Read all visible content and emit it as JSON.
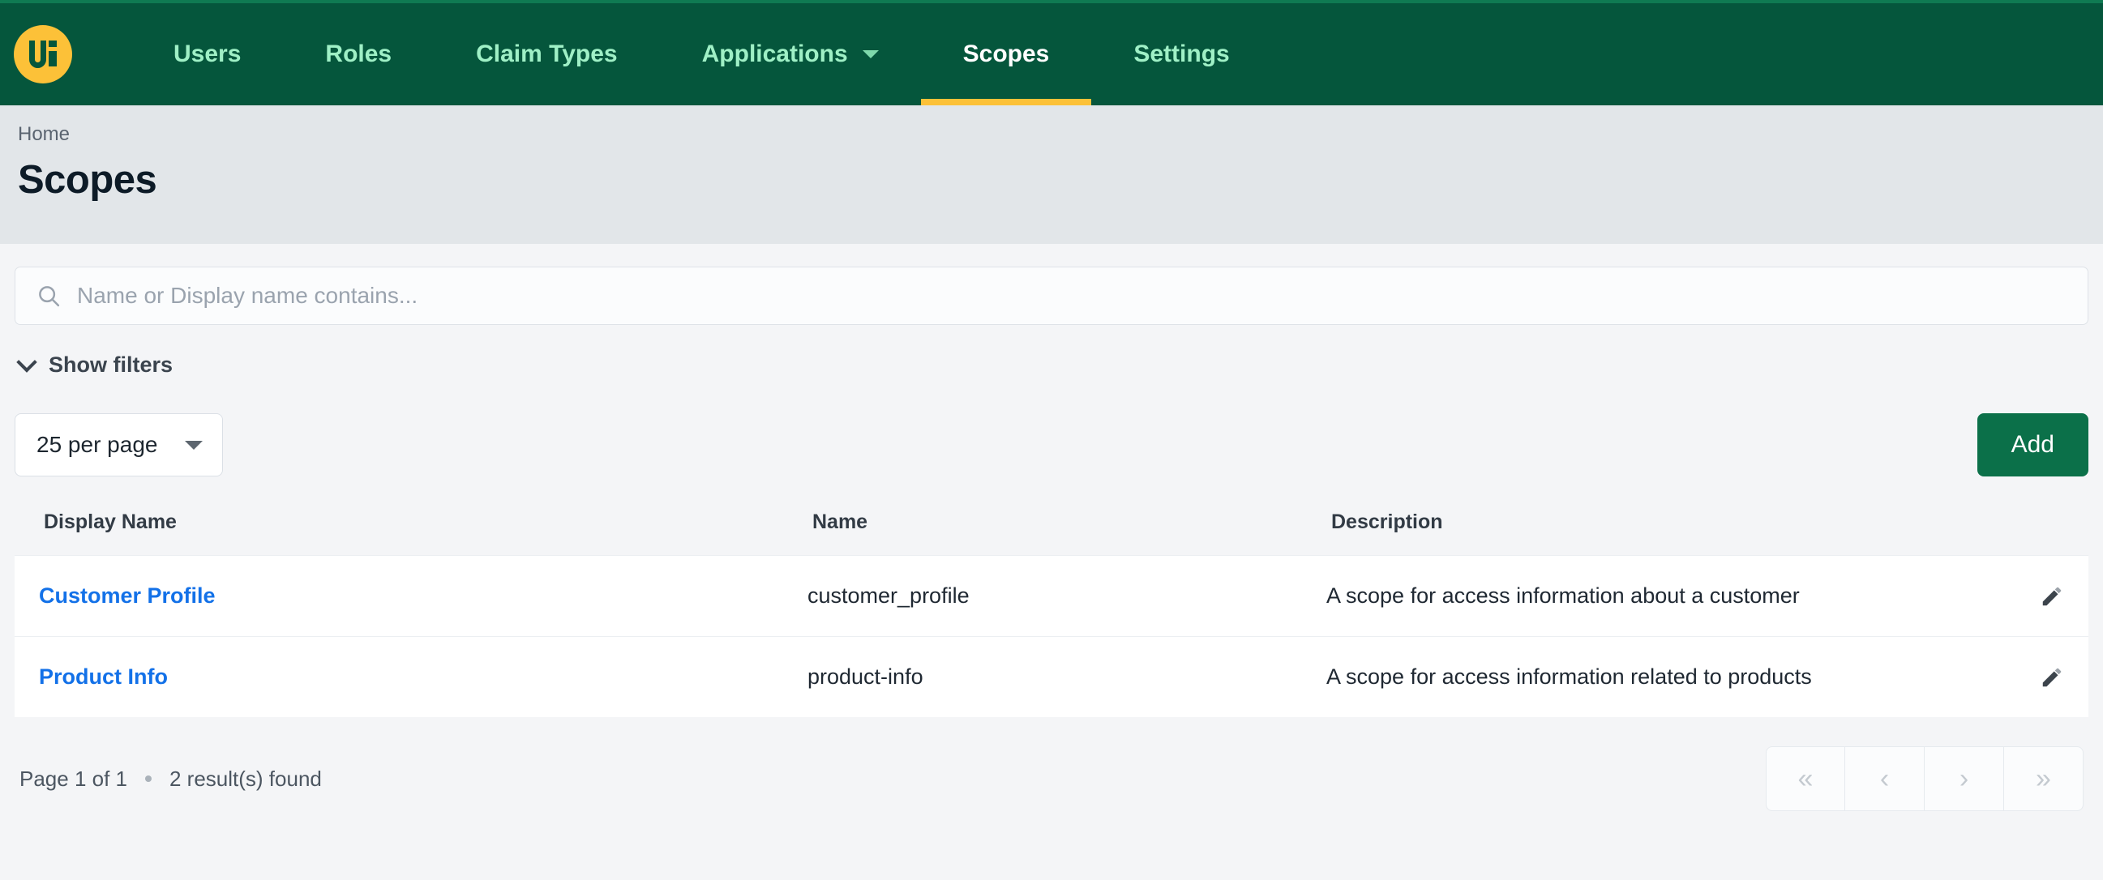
{
  "navbar": {
    "logo_name": "ui-logo",
    "items": [
      {
        "label": "Users",
        "active": false,
        "has_caret": false
      },
      {
        "label": "Roles",
        "active": false,
        "has_caret": false
      },
      {
        "label": "Claim Types",
        "active": false,
        "has_caret": false
      },
      {
        "label": "Applications",
        "active": false,
        "has_caret": true
      },
      {
        "label": "Scopes",
        "active": true,
        "has_caret": false
      },
      {
        "label": "Settings",
        "active": false,
        "has_caret": false
      }
    ]
  },
  "header": {
    "breadcrumb": "Home",
    "title": "Scopes"
  },
  "search": {
    "placeholder": "Name or Display name contains...",
    "value": ""
  },
  "filters": {
    "label": "Show filters"
  },
  "toolbar": {
    "per_page_label": "25 per page",
    "add_label": "Add"
  },
  "table": {
    "columns": [
      "Display Name",
      "Name",
      "Description"
    ],
    "rows": [
      {
        "display_name": "Customer Profile",
        "name": "customer_profile",
        "description": "A scope for access information about a customer"
      },
      {
        "display_name": "Product Info",
        "name": "product-info",
        "description": "A scope for access information related to products"
      }
    ]
  },
  "footer": {
    "page_text": "Page 1 of 1",
    "result_text": "2 result(s) found",
    "pager": [
      "«",
      "‹",
      "›",
      "»"
    ]
  },
  "colors": {
    "nav_bg": "#05563c",
    "nav_accent": "#fcc138",
    "nav_link": "#9ff0c6",
    "primary_button": "#0b7049",
    "link": "#1371e8",
    "header_bg": "#e2e6e9"
  }
}
